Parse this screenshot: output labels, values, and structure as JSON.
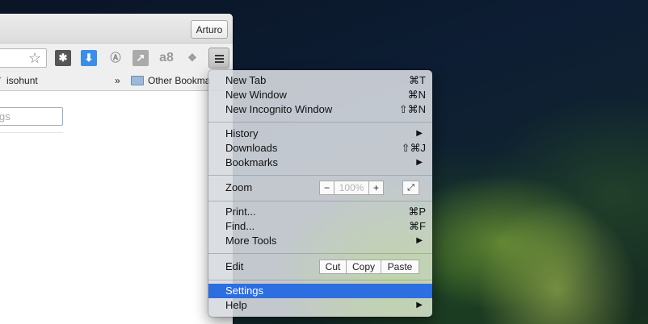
{
  "browser": {
    "profile_name": "Arturo",
    "bookmarks_bar": {
      "items": [
        "isohunt"
      ],
      "overflow": "»",
      "other_bookmarks": "Other Bookma"
    },
    "page": {
      "search_placeholder": "gs"
    }
  },
  "menu": {
    "items": [
      {
        "label": "New Tab",
        "shortcut": "⌘T"
      },
      {
        "label": "New Window",
        "shortcut": "⌘N"
      },
      {
        "label": "New Incognito Window",
        "shortcut": "⇧⌘N"
      },
      {
        "label": "History",
        "arrow": "▶"
      },
      {
        "label": "Downloads",
        "shortcut": "⇧⌘J"
      },
      {
        "label": "Bookmarks",
        "arrow": "▶"
      },
      {
        "label": "Print...",
        "shortcut": "⌘P"
      },
      {
        "label": "Find...",
        "shortcut": "⌘F"
      },
      {
        "label": "More Tools",
        "arrow": "▶"
      },
      {
        "label": "Settings"
      },
      {
        "label": "Help",
        "arrow": "▶"
      }
    ],
    "zoom": {
      "label": "Zoom",
      "minus": "−",
      "value": "100%",
      "plus": "+"
    },
    "edit": {
      "label": "Edit",
      "cut": "Cut",
      "copy": "Copy",
      "paste": "Paste"
    },
    "highlighted_item": "Settings",
    "highlight_color": "#2d6ee0"
  }
}
